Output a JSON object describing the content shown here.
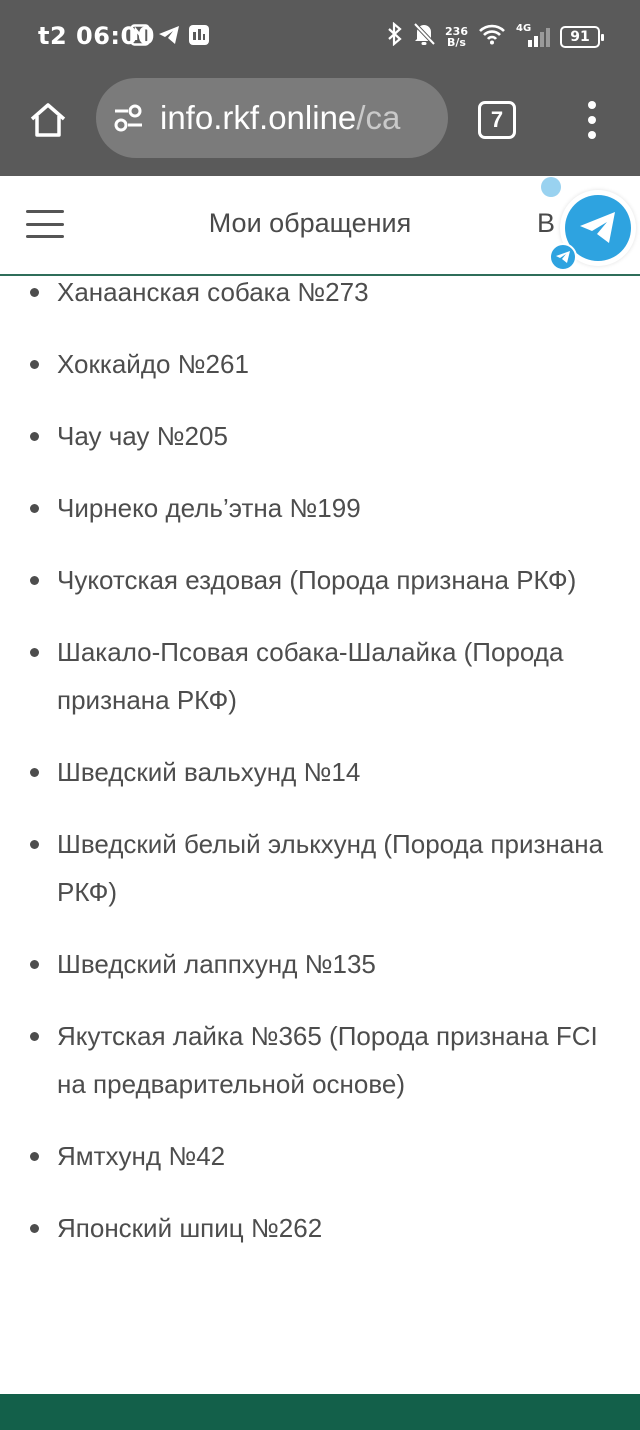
{
  "status_bar": {
    "time": "t2 06:00",
    "net_speed_value": "236",
    "net_speed_unit": "B/s",
    "network_type": "4G",
    "battery": "91",
    "icons": [
      "nfc-icon",
      "telegram-notification-icon",
      "message-notification-icon",
      "bluetooth-icon",
      "silent-icon",
      "wifi-icon",
      "signal-icon",
      "battery-icon"
    ]
  },
  "browser": {
    "url_host": "info.rkf.online",
    "url_path": "/ca",
    "tab_count": "7",
    "icons": [
      "home-icon",
      "site-settings-icon",
      "tab-switcher-icon",
      "overflow-menu-icon"
    ]
  },
  "site_header": {
    "title": "Мои обращения",
    "right_text": "В",
    "icons": [
      "hamburger-icon",
      "telegram-icon"
    ]
  },
  "breeds": [
    "Ханаанская собака №273",
    "Хоккайдо №261",
    "Чау чау №205",
    "Чирнеко дель’этна №199",
    "Чукотская ездовая (Порода признана РКФ)",
    "Шакало-Псовая собака-Шалайка (Порода признана РКФ)",
    "Шведский вальхунд №14",
    "Шведский белый элькхунд (Порода признана РКФ)",
    "Шведский лаппхунд №135",
    "Якутская лайка №365 (Порода признана FCI на предварительной основе)",
    "Ямтхунд №42",
    "Японский шпиц №262"
  ],
  "colors": {
    "system_bar": "#5a5a5a",
    "url_pill": "#7b7b7b",
    "accent_green": "#13604a",
    "telegram_blue": "#2ea3e0",
    "text": "#4d4d4d"
  }
}
